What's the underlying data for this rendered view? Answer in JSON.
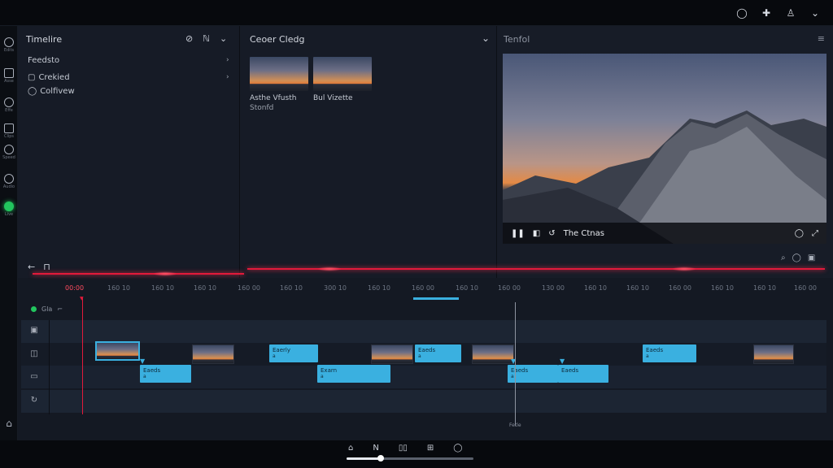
{
  "topbar": {
    "icons": [
      "circle-icon",
      "puzzle-icon",
      "user-icon",
      "chevron-down-icon"
    ]
  },
  "rail": {
    "items": [
      {
        "icon": "clock-icon",
        "label": "Edits"
      },
      {
        "icon": "layers-icon",
        "label": "Asse"
      },
      {
        "icon": "circle-icon",
        "label": "Effe"
      },
      {
        "icon": "film-icon",
        "label": "Clips"
      },
      {
        "icon": "gauge-icon",
        "label": "Speed"
      },
      {
        "icon": "clock-icon",
        "label": "Audio"
      },
      {
        "icon": "record-icon",
        "label": "Live"
      },
      {
        "icon": "home-icon",
        "label": ""
      }
    ],
    "accent": "#22c55e"
  },
  "panel1": {
    "title": "Timelire",
    "section": "Feedsto",
    "items": [
      {
        "label": "Crekied"
      },
      {
        "label": "Colfivew"
      }
    ]
  },
  "panel2": {
    "title": "Ceoer Cledg",
    "clips": [
      {
        "label": "Asthe Vfusth",
        "sub": "Stonfd"
      },
      {
        "label": "Bul Vizette",
        "sub": ""
      }
    ]
  },
  "panel3": {
    "title": "Tenfol",
    "player": {
      "title": "The Ctnas"
    }
  },
  "timeline": {
    "ruler_ticks": [
      "00:00",
      "160 10",
      "160 10",
      "160 10",
      "160 00",
      "160 10",
      "300 10",
      "160 10",
      "160 00",
      "160 10",
      "160 00",
      "130 00",
      "160 10",
      "160 10",
      "160 00",
      "160 10",
      "160 10",
      "160 00",
      "160 10"
    ],
    "track_header": "Gla",
    "playhead_label": "Fetle",
    "clips_row1": [
      {
        "label": "Eaerly",
        "sub": "a"
      },
      {
        "label": "Eaeds",
        "sub": "a"
      },
      {
        "label": "Eaeds",
        "sub": "a"
      }
    ],
    "clips_row2": [
      {
        "label": "Eaeds",
        "sub": "a"
      },
      {
        "label": "Exarn",
        "sub": "a"
      },
      {
        "label": "Eaeds",
        "sub": "a"
      },
      {
        "label": "Eaeds",
        "sub": ""
      }
    ],
    "colors": {
      "clip": "#3ab0e0",
      "playhead": "#e21a3b"
    }
  },
  "bottombar": {
    "icons": [
      "home-icon",
      "step-icon",
      "pause-icon",
      "skip-icon",
      "circle-icon"
    ],
    "scrub_progress": 0.26
  }
}
